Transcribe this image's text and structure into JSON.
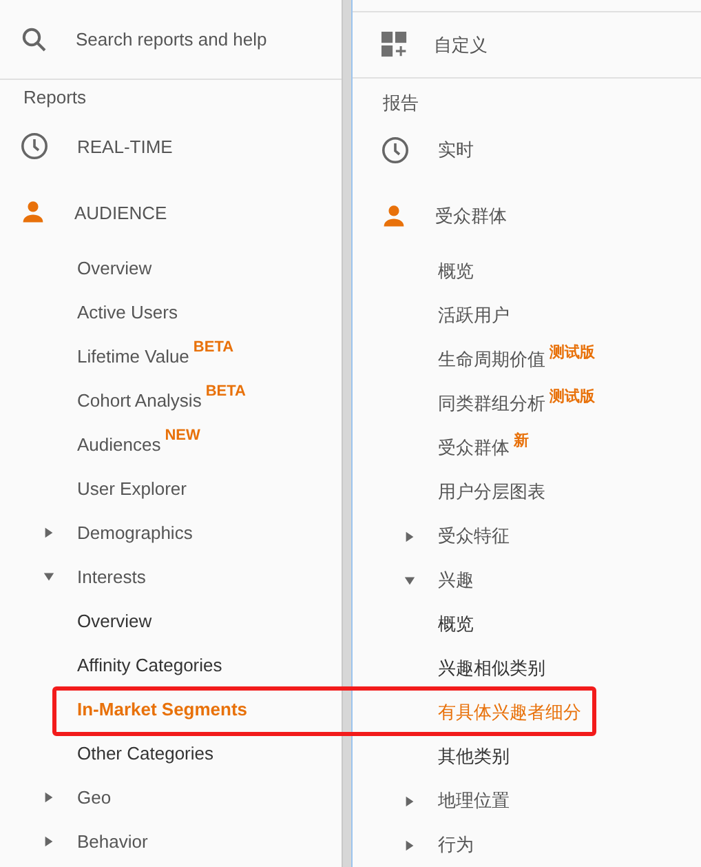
{
  "panels": [
    {
      "header": {
        "kind": "search",
        "placeholder": "Search reports and help"
      },
      "section_title": "Reports",
      "items": [
        {
          "label": "REAL-TIME",
          "kind": "realtime",
          "active": false
        },
        {
          "label": "AUDIENCE",
          "kind": "audience",
          "active": true,
          "children": [
            {
              "label": "Overview",
              "selected": false
            },
            {
              "label": "Active Users",
              "selected": false
            },
            {
              "label": "Lifetime Value",
              "badge": "BETA",
              "selected": false
            },
            {
              "label": "Cohort Analysis",
              "badge": "BETA",
              "selected": false
            },
            {
              "label": "Audiences",
              "badge": "NEW",
              "selected": false
            },
            {
              "label": "User Explorer",
              "selected": false
            },
            {
              "label": "Demographics",
              "expanded": false,
              "selected": false
            },
            {
              "label": "Interests",
              "expanded": true,
              "selected": false,
              "children": [
                {
                  "label": "Overview",
                  "selected": false
                },
                {
                  "label": "Affinity Categories",
                  "selected": false
                },
                {
                  "label": "In-Market Segments",
                  "selected": true
                },
                {
                  "label": "Other Categories",
                  "selected": false
                }
              ]
            },
            {
              "label": "Geo",
              "expanded": false,
              "selected": false
            },
            {
              "label": "Behavior",
              "expanded": false,
              "selected": false
            }
          ]
        }
      ]
    },
    {
      "header": {
        "kind": "customize",
        "label": "自定义"
      },
      "section_title": "报告",
      "items": [
        {
          "label": "实时",
          "kind": "realtime",
          "active": false
        },
        {
          "label": "受众群体",
          "kind": "audience",
          "active": true,
          "children": [
            {
              "label": "概览",
              "selected": false
            },
            {
              "label": "活跃用户",
              "selected": false
            },
            {
              "label": "生命周期价值",
              "badge": "测试版",
              "selected": false
            },
            {
              "label": "同类群组分析",
              "badge": "测试版",
              "selected": false
            },
            {
              "label": "受众群体",
              "badge": "新",
              "selected": false
            },
            {
              "label": "用户分层图表",
              "selected": false
            },
            {
              "label": "受众特征",
              "expanded": false,
              "selected": false
            },
            {
              "label": "兴趣",
              "expanded": true,
              "selected": false,
              "children": [
                {
                  "label": "概览",
                  "selected": false
                },
                {
                  "label": "兴趣相似类别",
                  "selected": false
                },
                {
                  "label": "有具体兴趣者细分",
                  "selected": true
                },
                {
                  "label": "其他类别",
                  "selected": false
                }
              ]
            },
            {
              "label": "地理位置",
              "expanded": false,
              "selected": false
            },
            {
              "label": "行为",
              "expanded": false,
              "selected": false
            }
          ]
        }
      ]
    }
  ]
}
